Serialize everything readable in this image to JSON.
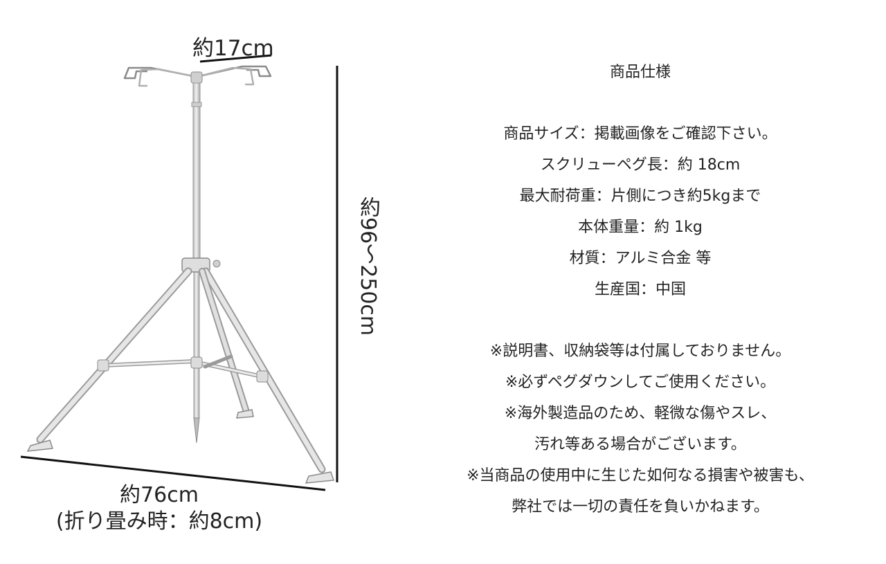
{
  "dimensions": {
    "top_width": "約17cm",
    "height": "約96～250cm",
    "base_width": "約76cm",
    "folded_width": "(折り畳み時：約8cm)"
  },
  "specs": {
    "title": "商品仕様",
    "items": [
      "商品サイズ：掲載画像をご確認下さい。",
      "スクリューペグ長：約 18cm",
      "最大耐荷重：片側につき約5kgまで",
      "本体重量：約 1kg",
      "材質：アルミ合金 等",
      "生産国：中国"
    ],
    "notes": [
      "※説明書、収納袋等は付属しておりません。",
      "※必ずペグダウンしてご使用ください。",
      "※海外製造品のため、軽微な傷やスレ、",
      "汚れ等ある場合がございます。",
      "※当商品の使用中に生じた如何なる損害や被害も、",
      "弊社では一切の責任を負いかねます。"
    ]
  },
  "colors": {
    "text": "#222222",
    "metal": "#d9d9d9",
    "metal_edge": "#9a9a9a",
    "dimension_line": "#111111"
  }
}
